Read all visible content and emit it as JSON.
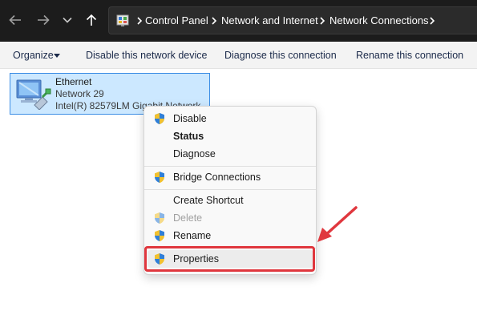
{
  "breadcrumb": {
    "items": [
      "Control Panel",
      "Network and Internet",
      "Network Connections"
    ]
  },
  "commandbar": {
    "organize_label": "Organize",
    "disable_label": "Disable this network device",
    "diagnose_label": "Diagnose this connection",
    "rename_label": "Rename this connection"
  },
  "connection": {
    "name": "Ethernet",
    "network": "Network 29",
    "adapter": "Intel(R) 82579LM Gigabit Network"
  },
  "context_menu": {
    "items": [
      {
        "label": "Disable",
        "icon": "shield-icon"
      },
      {
        "label": "Status",
        "icon": ""
      },
      {
        "label": "Diagnose",
        "icon": ""
      },
      {
        "label": "Bridge Connections",
        "icon": "shield-icon"
      },
      {
        "label": "Create Shortcut",
        "icon": ""
      },
      {
        "label": "Delete",
        "icon": "shield-icon"
      },
      {
        "label": "Rename",
        "icon": "shield-icon"
      },
      {
        "label": "Properties",
        "icon": "shield-icon"
      }
    ]
  },
  "colors": {
    "address_bar": "#1c1c1c",
    "selection": "#cce8ff",
    "annotation": "#e0373e"
  }
}
